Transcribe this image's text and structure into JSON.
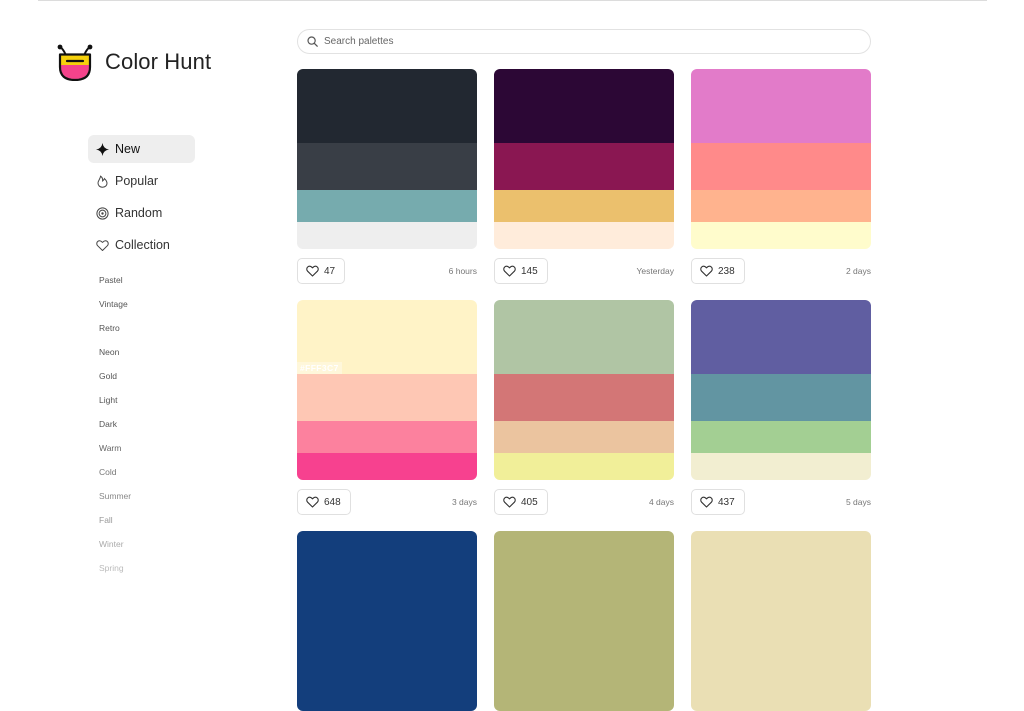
{
  "brand": {
    "name": "Color Hunt"
  },
  "nav": [
    {
      "label": "New",
      "icon": "sparkle-icon",
      "active": true
    },
    {
      "label": "Popular",
      "icon": "flame-icon",
      "active": false
    },
    {
      "label": "Random",
      "icon": "spiral-icon",
      "active": false
    },
    {
      "label": "Collection",
      "icon": "heart-icon",
      "active": false
    }
  ],
  "tags": [
    {
      "label": "Pastel",
      "color": "#555555"
    },
    {
      "label": "Vintage",
      "color": "#555555"
    },
    {
      "label": "Retro",
      "color": "#555555"
    },
    {
      "label": "Neon",
      "color": "#555555"
    },
    {
      "label": "Gold",
      "color": "#555555"
    },
    {
      "label": "Light",
      "color": "#555555"
    },
    {
      "label": "Dark",
      "color": "#555555"
    },
    {
      "label": "Warm",
      "color": "#666666"
    },
    {
      "label": "Cold",
      "color": "#777777"
    },
    {
      "label": "Summer",
      "color": "#888888"
    },
    {
      "label": "Fall",
      "color": "#999999"
    },
    {
      "label": "Winter",
      "color": "#aaaaaa"
    },
    {
      "label": "Spring",
      "color": "#bbbbbb"
    }
  ],
  "search": {
    "placeholder": "Search palettes",
    "value": ""
  },
  "palettes": [
    {
      "colors": [
        "#222831",
        "#393E46",
        "#76ABAE",
        "#EEEEEE"
      ],
      "likes": "47",
      "date": "6 hours"
    },
    {
      "colors": [
        "#2C0735",
        "#8A1752",
        "#EBC06D",
        "#FFECDB"
      ],
      "likes": "145",
      "date": "Yesterday"
    },
    {
      "colors": [
        "#E27BC9",
        "#FF8A8A",
        "#FFB38E",
        "#FFFCCC"
      ],
      "likes": "238",
      "date": "2 days"
    },
    {
      "colors": [
        "#FFF3C7",
        "#FEC7B4",
        "#FC819E",
        "#F7418F"
      ],
      "likes": "648",
      "date": "3 days",
      "hex_label": "#FFF3C7"
    },
    {
      "colors": [
        "#B0C5A4",
        "#D37676",
        "#EBC49F",
        "#F1EF99"
      ],
      "likes": "405",
      "date": "4 days"
    },
    {
      "colors": [
        "#605EA1",
        "#6295A2",
        "#A3CF93",
        "#F2EED1"
      ],
      "likes": "437",
      "date": "5 days"
    },
    {
      "colors": [
        "#133E7C",
        "#133E7C",
        "#133E7C",
        "#133E7C"
      ],
      "likes": "",
      "date": ""
    },
    {
      "colors": [
        "#B4B577",
        "#B4B577",
        "#B4B577",
        "#B4B577"
      ],
      "likes": "",
      "date": ""
    },
    {
      "colors": [
        "#EADFB4",
        "#EADFB4",
        "#EADFB4",
        "#EADFB4"
      ],
      "likes": "",
      "date": ""
    }
  ]
}
